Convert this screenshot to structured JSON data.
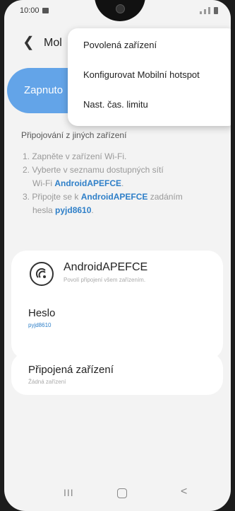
{
  "status_bar": {
    "time": "10:00",
    "icons": [
      "image-icon",
      "signal-icon",
      "battery-icon"
    ]
  },
  "header": {
    "back_icon": "chevron-left-icon",
    "title_partial": "Mol"
  },
  "toggle": {
    "label_partial": "Zapnuto",
    "accent_color": "#63a4e8"
  },
  "info": {
    "title": "Připojování z jiných zařízení",
    "step1": "1. Zapněte v zařízení Wi-Fi.",
    "step2_line1": "2. Vyberte v seznamu dostupných sítí",
    "step2_prefix": "Wi-Fi ",
    "step2_network": "AndroidAPEFCE",
    "step2_suffix": ".",
    "step3_prefix": "3. Připojte se k ",
    "step3_network": "AndroidAPEFCE",
    "step3_mid": " zadáním",
    "step3_line2_prefix": "hesla ",
    "step3_password": "pyjd8610",
    "step3_suffix": "."
  },
  "network": {
    "name": "AndroidAPEFCE",
    "subtitle": "Povolí připojení všem zařízením.",
    "icon": "wifi-hotspot-icon"
  },
  "password": {
    "label": "Heslo",
    "value": "pyjd8610"
  },
  "connected": {
    "title": "Připojená zařízení",
    "subtitle": "Žádná zařízení"
  },
  "menu": {
    "items": [
      "Povolená zařízení",
      "Konfigurovat Mobilní hotspot",
      "Nast. čas. limitu"
    ]
  },
  "nav_bar": {
    "recent_label": "III",
    "back_label": "<"
  }
}
